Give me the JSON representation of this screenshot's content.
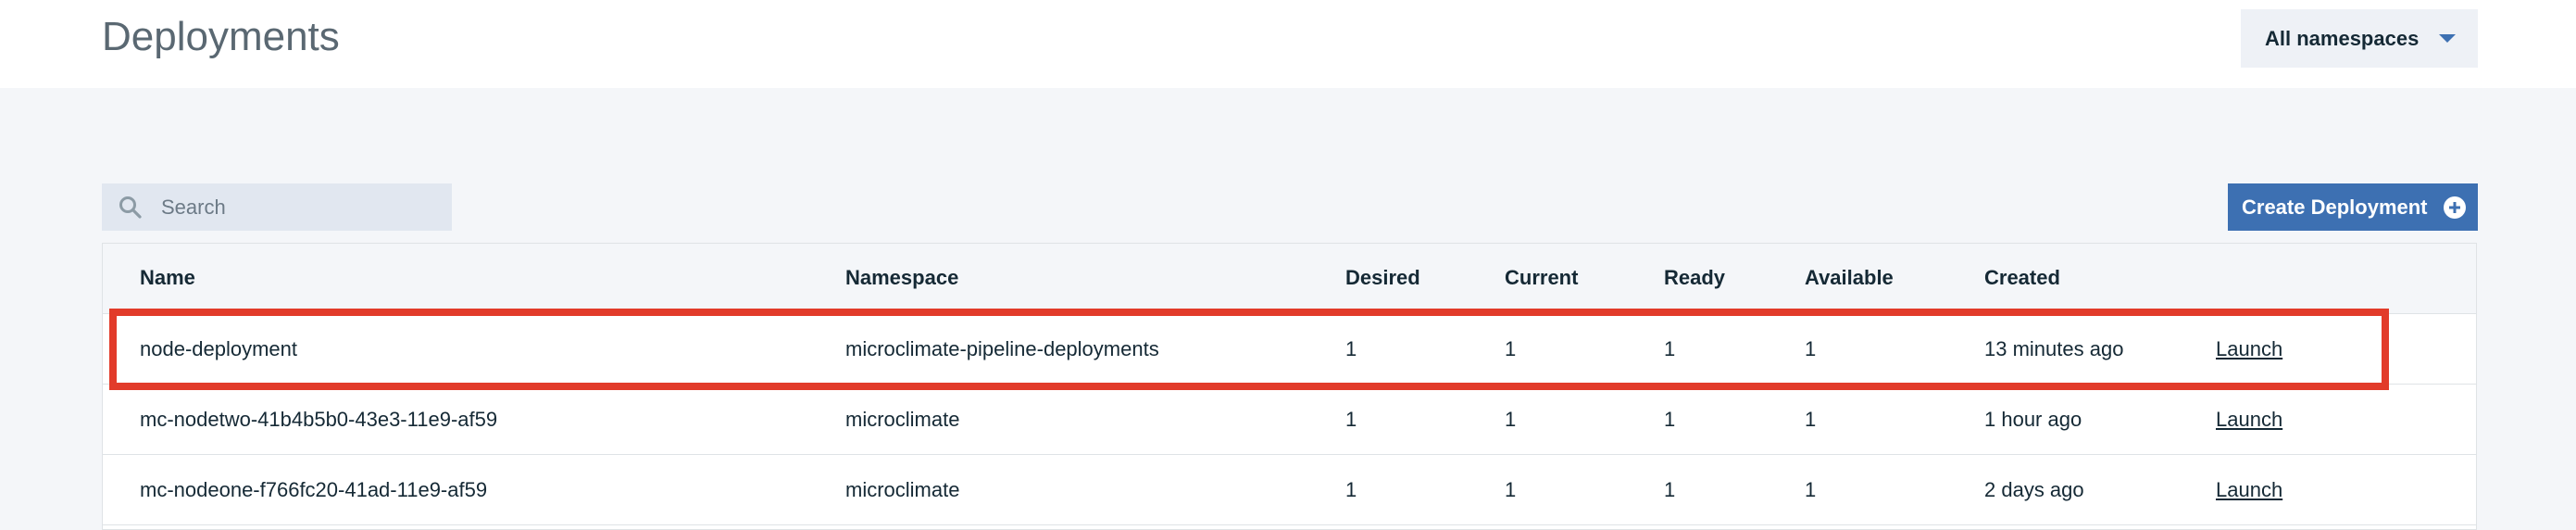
{
  "header": {
    "title": "Deployments",
    "namespace_selector": "All namespaces"
  },
  "toolbar": {
    "search_placeholder": "Search",
    "create_label": "Create Deployment"
  },
  "table": {
    "columns": [
      "Name",
      "Namespace",
      "Desired",
      "Current",
      "Ready",
      "Available",
      "Created"
    ],
    "rows": [
      {
        "name": "node-deployment",
        "namespace": "microclimate-pipeline-deployments",
        "desired": "1",
        "current": "1",
        "ready": "1",
        "available": "1",
        "created": "13 minutes ago",
        "action": "Launch",
        "highlighted": true
      },
      {
        "name": "mc-nodetwo-41b4b5b0-43e3-11e9-af59",
        "namespace": "microclimate",
        "desired": "1",
        "current": "1",
        "ready": "1",
        "available": "1",
        "created": "1 hour ago",
        "action": "Launch"
      },
      {
        "name": "mc-nodeone-f766fc20-41ad-11e9-af59",
        "namespace": "microclimate",
        "desired": "1",
        "current": "1",
        "ready": "1",
        "available": "1",
        "created": "2 days ago",
        "action": "Launch"
      }
    ]
  },
  "colors": {
    "accent": "#3d70b2",
    "highlight": "#e23b2a"
  },
  "icons": {
    "search": "search-icon",
    "dropdown": "caret-down-icon",
    "create": "add-circle-icon"
  }
}
